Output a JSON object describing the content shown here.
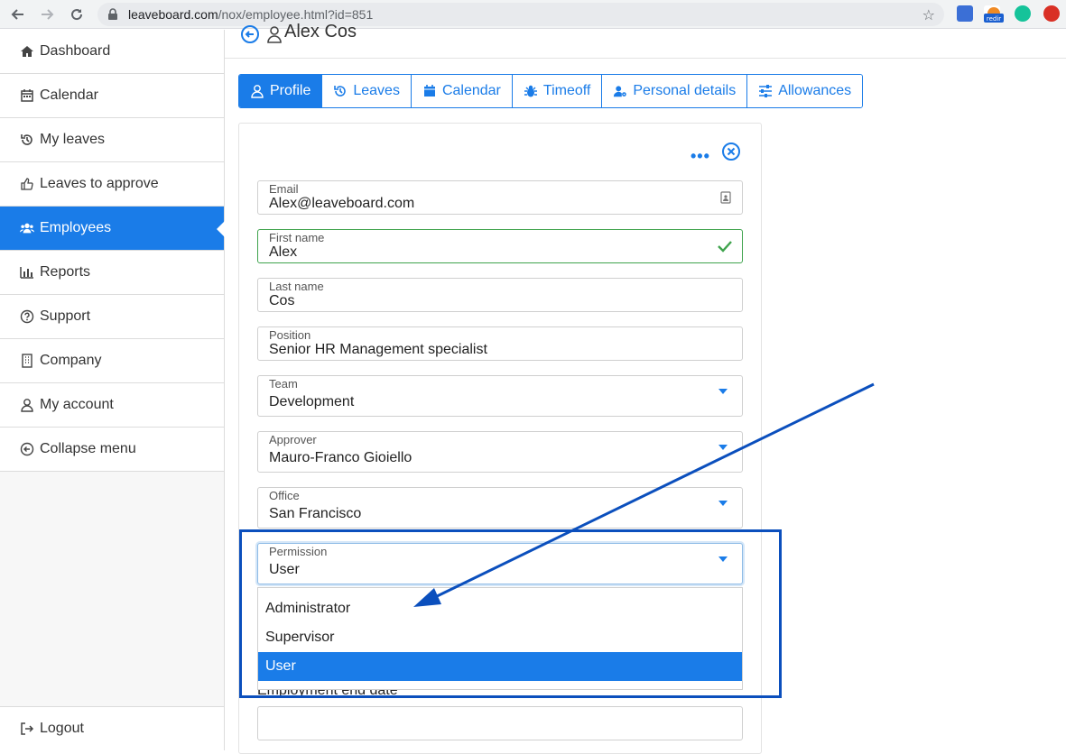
{
  "browser": {
    "url_host": "leaveboard.com",
    "url_path": "/nox/employee.html?id=851",
    "ext_redir_label": "redir"
  },
  "sidebar": {
    "items": [
      {
        "label": "Dashboard",
        "icon": "home-icon"
      },
      {
        "label": "Calendar",
        "icon": "calendar-icon"
      },
      {
        "label": "My leaves",
        "icon": "history-icon"
      },
      {
        "label": "Leaves to approve",
        "icon": "thumbs-up-icon"
      },
      {
        "label": "Employees",
        "icon": "users-icon",
        "active": true
      },
      {
        "label": "Reports",
        "icon": "bar-chart-icon"
      },
      {
        "label": "Support",
        "icon": "question-icon"
      },
      {
        "label": "Company",
        "icon": "building-icon"
      },
      {
        "label": "My account",
        "icon": "user-icon"
      },
      {
        "label": "Collapse menu",
        "icon": "circle-arrow-left-icon"
      }
    ],
    "logout": "Logout"
  },
  "header": {
    "title": "Alex Cos"
  },
  "tabs": [
    {
      "label": "Profile",
      "active": true
    },
    {
      "label": "Leaves"
    },
    {
      "label": "Calendar"
    },
    {
      "label": "Timeoff"
    },
    {
      "label": "Personal details"
    },
    {
      "label": "Allowances"
    }
  ],
  "form": {
    "email": {
      "label": "Email",
      "value": "Alex@leaveboard.com"
    },
    "first_name": {
      "label": "First name",
      "value": "Alex"
    },
    "last_name": {
      "label": "Last name",
      "value": "Cos"
    },
    "position": {
      "label": "Position",
      "value": "Senior HR Management specialist"
    },
    "team": {
      "label": "Team",
      "value": "Development"
    },
    "approver": {
      "label": "Approver",
      "value": "Mauro-Franco Gioiello"
    },
    "office": {
      "label": "Office",
      "value": "San Francisco"
    },
    "permission": {
      "label": "Permission",
      "value": "User",
      "options": [
        "Administrator",
        "Supervisor",
        "User"
      ],
      "selected": "User"
    },
    "employment_end_date": {
      "label": "Employment end date",
      "value": ""
    }
  },
  "colors": {
    "accent": "#1a7ce8",
    "valid": "#3fa34d",
    "annotation": "#0b4fbd"
  }
}
